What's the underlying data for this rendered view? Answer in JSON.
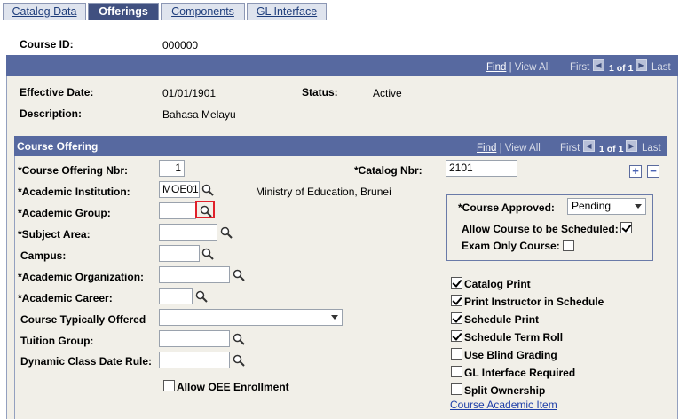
{
  "tabs": [
    {
      "label": "Catalog Data",
      "active": false
    },
    {
      "label": "Offerings",
      "active": true
    },
    {
      "label": "Components",
      "active": false
    },
    {
      "label": "GL Interface",
      "active": false
    }
  ],
  "course_id": {
    "label": "Course ID:",
    "value": "000000"
  },
  "effdt_nav": {
    "find": "Find",
    "view_all": "View All",
    "first": "First",
    "counter": "1 of 1",
    "last": "Last"
  },
  "effdt": {
    "effective_date_label": "Effective Date:",
    "effective_date": "01/01/1901",
    "status_label": "Status:",
    "status": "Active",
    "description_label": "Description:",
    "description": "Bahasa Melayu"
  },
  "offering": {
    "title": "Course Offering",
    "nav": {
      "find": "Find",
      "view_all": "View All",
      "first": "First",
      "counter": "1 of 1",
      "last": "Last"
    },
    "offering_nbr_label": "*Course Offering Nbr:",
    "offering_nbr": "1",
    "catalog_nbr_label": "*Catalog Nbr:",
    "catalog_nbr": "2101",
    "institution_label": "*Academic Institution:",
    "institution": "MOE01",
    "institution_desc": "Ministry of Education, Brunei",
    "group_label": "*Academic Group:",
    "group": "",
    "subject_label": "*Subject Area:",
    "subject": "",
    "campus_label": "Campus:",
    "campus": "",
    "organization_label": "*Academic Organization:",
    "organization": "",
    "career_label": "*Academic Career:",
    "career": "",
    "typically_offered_label": "Course Typically Offered",
    "typically_offered": "",
    "tuition_label": "Tuition Group:",
    "tuition": "",
    "dynamic_label": "Dynamic Class Date Rule:",
    "dynamic": "",
    "oee_label": "Allow OEE Enrollment",
    "approved_label": "*Course Approved:",
    "approved": "Pending",
    "allow_schedule_label": "Allow Course to be Scheduled:",
    "exam_only_label": "Exam Only Course:",
    "checkboxes": [
      {
        "label": "Catalog Print",
        "checked": true
      },
      {
        "label": "Print Instructor in Schedule",
        "checked": true
      },
      {
        "label": "Schedule Print",
        "checked": true
      },
      {
        "label": "Schedule Term Roll",
        "checked": true
      },
      {
        "label": "Use Blind Grading",
        "checked": false
      },
      {
        "label": "GL Interface Required",
        "checked": false
      },
      {
        "label": "Split Ownership",
        "checked": false
      }
    ],
    "academic_item_link": "Course Academic Item"
  },
  "colors": {
    "header": "#5769a0",
    "active_tab": "#405080",
    "highlight": "#e0202a",
    "panel_bg": "#f1efe8"
  }
}
